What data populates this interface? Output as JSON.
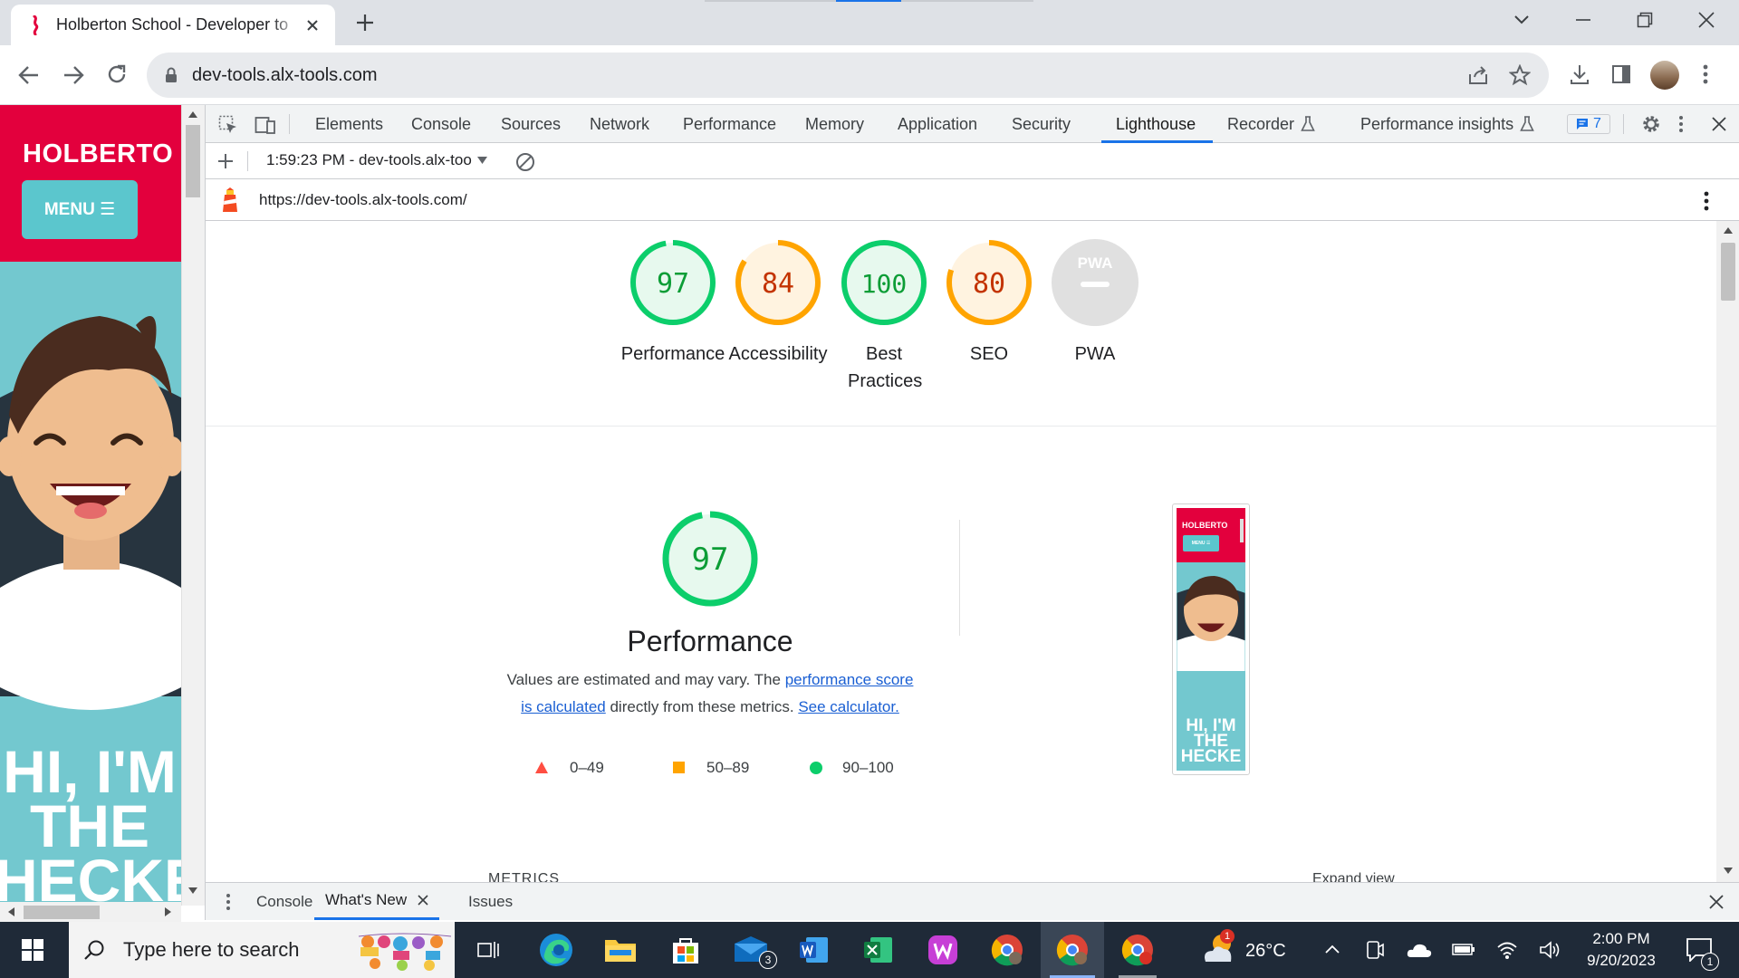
{
  "browser": {
    "tab_title": "Holberton School - Developer to",
    "url": "dev-tools.alx-tools.com"
  },
  "page": {
    "brand": "HOLBERTO",
    "menu_label": "MENU ☰",
    "hero_lines": [
      "HI, I'M",
      "THE",
      "HECKE"
    ]
  },
  "devtools": {
    "tabs": [
      "Elements",
      "Console",
      "Sources",
      "Network",
      "Performance",
      "Memory",
      "Application",
      "Security",
      "Lighthouse",
      "Recorder",
      "Performance insights"
    ],
    "active_tab": "Lighthouse",
    "issues_count": "7",
    "report_selector": "1:59:23 PM - dev-tools.alx-too",
    "report_url": "https://dev-tools.alx-tools.com/",
    "drawer_tabs": [
      "Console",
      "What's New",
      "Issues"
    ]
  },
  "lighthouse": {
    "scores": [
      {
        "label": "Performance",
        "value": 97,
        "color": "#0c9d36",
        "fill": "#e7f9ee",
        "ring": "#0cce6b"
      },
      {
        "label": "Accessibility",
        "value": 84,
        "color": "#c33300",
        "fill": "#fff3e0",
        "ring": "#ffa400"
      },
      {
        "label": "Best Practices",
        "value": 100,
        "color": "#0c9d36",
        "fill": "#e7f9ee",
        "ring": "#0cce6b"
      },
      {
        "label": "SEO",
        "value": 80,
        "color": "#c33300",
        "fill": "#fff3e0",
        "ring": "#ffa400"
      },
      {
        "label": "PWA",
        "value": null,
        "badge": "PWA"
      }
    ],
    "perf_score": "97",
    "perf_title": "Performance",
    "perf_desc_1": "Values are estimated and may vary. The",
    "perf_link_1a": "performance score",
    "perf_link_1b": "is calculated",
    "perf_desc_2": "directly from these metrics.",
    "perf_link_2": "See calculator.",
    "legend": [
      {
        "range": "0–49",
        "shape": "triangle",
        "color": "#ff4e42"
      },
      {
        "range": "50–89",
        "shape": "square",
        "color": "#ffa400"
      },
      {
        "range": "90–100",
        "shape": "circle",
        "color": "#0cce6b"
      }
    ],
    "metrics_label": "METRICS",
    "expand_view": "Expand view",
    "thumb_brand": "HOLBERTO",
    "thumb_menu": "MENU ☰",
    "thumb_hero": [
      "HI, I'M",
      "THE",
      "HECKE"
    ]
  },
  "taskbar": {
    "search_placeholder": "Type here to search",
    "temperature": "26°C",
    "time": "2:00 PM",
    "date": "9/20/2023",
    "mail_badge": "3",
    "notif_badge": "1",
    "weather_badge": "1"
  },
  "colors": {
    "brand_red": "#e3003d",
    "brand_teal": "#73c8cf",
    "devtools_blue": "#1a73e8"
  }
}
